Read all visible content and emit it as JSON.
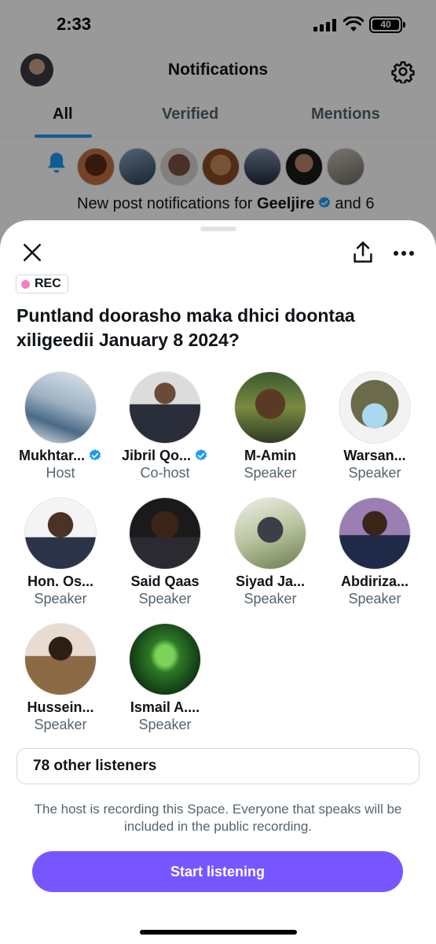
{
  "status_bar": {
    "time": "2:33",
    "battery": "40"
  },
  "header": {
    "title": "Notifications"
  },
  "tabs": [
    {
      "label": "All",
      "active": true
    },
    {
      "label": "Verified",
      "active": false
    },
    {
      "label": "Mentions",
      "active": false
    }
  ],
  "notification": {
    "text_prefix": "New post notifications for",
    "name": "Geeljire",
    "text_suffix": "and 6"
  },
  "sheet": {
    "rec_label": "REC",
    "title": "Puntland doorasho maka dhici doontaa xiligeedii January 8  2024?",
    "speakers": [
      {
        "name": "Mukhtar...",
        "role": "Host",
        "verified": true
      },
      {
        "name": "Jibril Qo...",
        "role": "Co-host",
        "verified": true
      },
      {
        "name": "M-Amin",
        "role": "Speaker",
        "verified": false
      },
      {
        "name": "Warsan...",
        "role": "Speaker",
        "verified": false
      },
      {
        "name": "Hon. Os...",
        "role": "Speaker",
        "verified": false
      },
      {
        "name": "Said Qaas",
        "role": "Speaker",
        "verified": false
      },
      {
        "name": "Siyad Ja...",
        "role": "Speaker",
        "verified": false
      },
      {
        "name": "Abdiriza...",
        "role": "Speaker",
        "verified": false
      },
      {
        "name": "Hussein...",
        "role": "Speaker",
        "verified": false
      },
      {
        "name": "Ismail A....",
        "role": "Speaker",
        "verified": false
      }
    ],
    "listeners": "78 other listeners",
    "recording_note": "The host is recording this Space. Everyone that speaks will be included in the public recording.",
    "start_button": "Start listening"
  },
  "colors": {
    "accent": "#7856ff",
    "verified": "#1d9bf0",
    "rec_dot": "#f47ec2",
    "secondary_text": "#536471"
  },
  "icons": [
    "signal-icon",
    "wifi-icon",
    "gear-icon",
    "bell-icon",
    "verified-icon",
    "close-icon",
    "share-icon",
    "more-icon"
  ]
}
